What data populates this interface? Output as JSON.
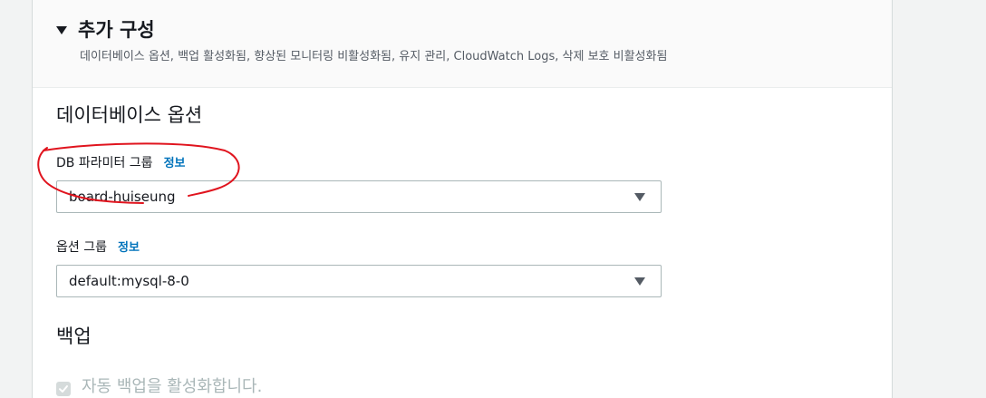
{
  "additional_config": {
    "title": "추가 구성",
    "description": "데이터베이스 옵션, 백업 활성화됨, 향상된 모니터링 비활성화됨, 유지 관리, CloudWatch Logs, 삭제 보호 비활성화됨"
  },
  "db_options": {
    "title": "데이터베이스 옵션",
    "parameter_group": {
      "label": "DB 파라미터 그룹",
      "info": "정보",
      "value": "board-huiseung"
    },
    "option_group": {
      "label": "옵션 그룹",
      "info": "정보",
      "value": "default:mysql-8-0"
    }
  },
  "backup": {
    "title": "백업",
    "auto_backup": {
      "label": "자동 백업을 활성화합니다.",
      "checked": true,
      "disabled": true
    }
  },
  "colors": {
    "link": "#0073bb",
    "annotation": "#e0141e",
    "disabled": "#aab7b8"
  }
}
